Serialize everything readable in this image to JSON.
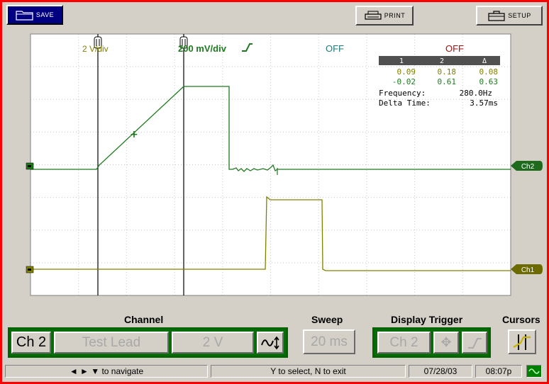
{
  "toolbar": {
    "save_label": "SAVE",
    "print_label": "PRINT",
    "setup_label": "SETUP"
  },
  "scope": {
    "ch1_scale": "2 V/div",
    "ch2_scale": "200 mV/div",
    "cursor1_label": "OFF",
    "cursor2_label": "OFF",
    "ch1_tag": "Ch1",
    "ch2_tag": "Ch2",
    "colors": {
      "ch1": "#808000",
      "ch2": "#1e7a1e",
      "grid": "#c8c8c8",
      "plot_bg": "#ffffff"
    }
  },
  "readout": {
    "headers": [
      "1",
      "2",
      "Δ"
    ],
    "row1": [
      "0.09",
      "0.18",
      "0.08"
    ],
    "row2": [
      "-0.02",
      "0.61",
      "0.63"
    ],
    "frequency_label": "Frequency:",
    "frequency_value": "280.0Hz",
    "delta_label": "Delta Time:",
    "delta_value": "3.57ms"
  },
  "controls": {
    "channel_title": "Channel",
    "channel_value": "Ch 2",
    "probe_value": "Test Lead",
    "volts_value": "2 V",
    "sweep_title": "Sweep",
    "sweep_value": "20 ms",
    "trigger_title": "Display Trigger",
    "trigger_channel": "Ch 2",
    "cursors_title": "Cursors"
  },
  "status": {
    "navigate": "◄ ► ▼ to navigate",
    "select": "Y to select, N to exit",
    "date": "07/28/03",
    "time": "08:07p"
  }
}
